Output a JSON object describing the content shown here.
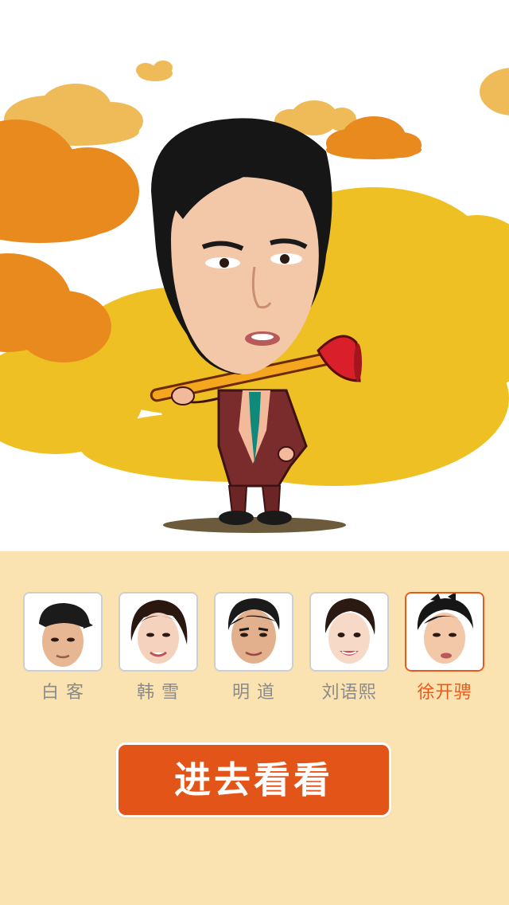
{
  "colors": {
    "panel_background": "#fae3b1",
    "accent": "#e95a1a",
    "button_background": "#e25418",
    "cloud_orange": "#e88a1e",
    "cloud_light": "#efbb58",
    "cloud_yellow": "#efc024"
  },
  "characters": [
    {
      "name": "白 客",
      "icon": "face-avatar-cap",
      "selected": false
    },
    {
      "name": "韩 雪",
      "icon": "face-avatar-woman",
      "selected": false
    },
    {
      "name": "明 道",
      "icon": "face-avatar-man",
      "selected": false
    },
    {
      "name": "刘语熙",
      "icon": "face-avatar-woman-smiling",
      "selected": false
    },
    {
      "name": "徐开骋",
      "icon": "face-avatar-spiky-hair",
      "selected": true
    }
  ],
  "enter_button": {
    "label": "进去看看"
  }
}
